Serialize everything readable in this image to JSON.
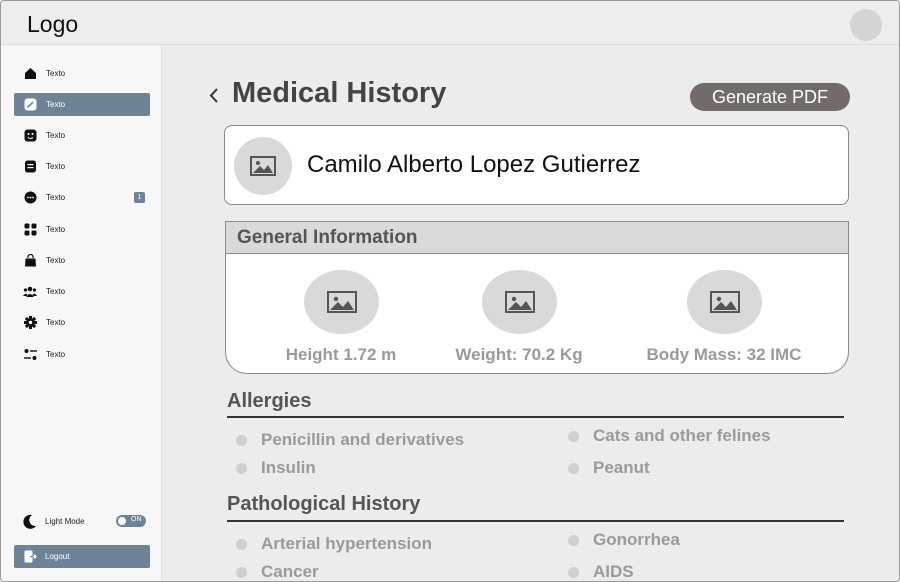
{
  "header": {
    "logo": "Logo"
  },
  "sidebar": {
    "items": [
      {
        "label": "Texto",
        "icon": "home-icon"
      },
      {
        "label": "Texto",
        "icon": "edit-icon",
        "active": true
      },
      {
        "label": "Texto",
        "icon": "face-icon"
      },
      {
        "label": "Texto",
        "icon": "document-icon"
      },
      {
        "label": "Texto",
        "icon": "chat-icon",
        "badge": "1"
      },
      {
        "label": "Texto",
        "icon": "grid-icon"
      },
      {
        "label": "Texto",
        "icon": "bag-icon"
      },
      {
        "label": "Texto",
        "icon": "users-icon"
      },
      {
        "label": "Texto",
        "icon": "gear-icon"
      },
      {
        "label": "Texto",
        "icon": "sliders-icon"
      }
    ],
    "mode_label": "Light Mode",
    "mode_toggle": "ON",
    "logout_label": "Logout"
  },
  "page": {
    "title": "Medical History",
    "pdf_button": "Generate PDF",
    "patient_name": "Camilo Alberto Lopez Gutierrez"
  },
  "general": {
    "title": "General Information",
    "height": "Height 1.72 m",
    "weight": "Weight: 70.2 Kg",
    "bmi": "Body Mass: 32 IMC"
  },
  "allergies": {
    "title": "Allergies",
    "items": [
      "Penicillin and derivatives",
      "Insulin",
      "Cats and other felines",
      "Peanut"
    ]
  },
  "pathological": {
    "title": "Pathological History",
    "items": [
      "Arterial hypertension",
      "Cancer",
      "Gonorrhea",
      "AIDS"
    ]
  },
  "colors": {
    "accent": "#6e8496",
    "pdf_button": "#736a6a"
  }
}
